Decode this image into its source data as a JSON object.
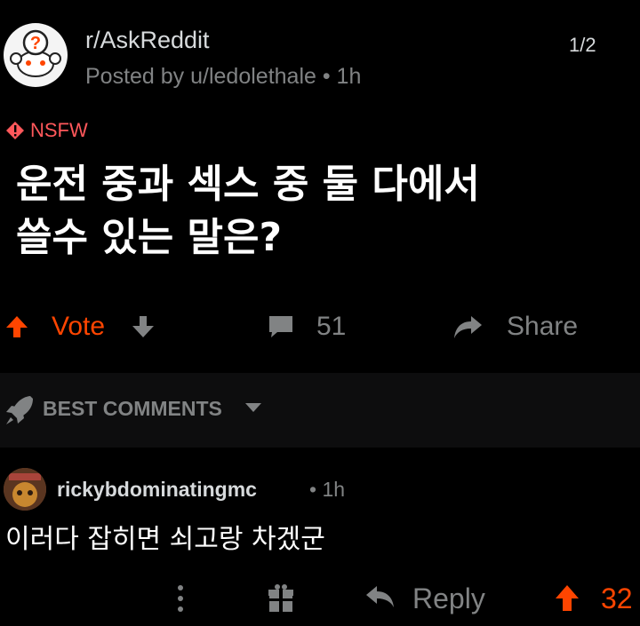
{
  "post": {
    "subreddit": "r/AskReddit",
    "posted_by": "Posted by u/ledolethale • 1h",
    "page_indicator": "1/2",
    "nsfw_label": "NSFW",
    "title_line1": "운전 중과 섹스  중 둘 다에서",
    "title_line2": "쓸수 있는 말은?"
  },
  "actions": {
    "vote_label": "Vote",
    "comment_count": "51",
    "share_label": "Share"
  },
  "sort": {
    "label": "BEST COMMENTS"
  },
  "comment": {
    "username": "rickybdominatingmc",
    "time": "• 1h",
    "body": "이러다 잡히면 쇠고랑 차겠군",
    "reply_label": "Reply",
    "score": "32"
  },
  "colors": {
    "background": "#000000",
    "upvote": "#ff4500",
    "nsfw": "#ff585b",
    "muted": "#818384"
  }
}
